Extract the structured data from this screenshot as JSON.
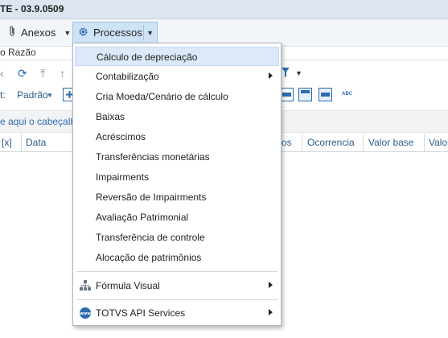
{
  "window": {
    "title": "TE - 03.9.0509"
  },
  "menubar": {
    "anexos_label": "Anexos",
    "processos_label": "Processos"
  },
  "group": {
    "label": "o Razão"
  },
  "toolbar": {
    "view_prefix": "t:",
    "view_label": "Padrão",
    "abc_label": "ABC"
  },
  "hint": {
    "text": "e aqui o cabeçalho"
  },
  "grid": {
    "columns": [
      "[x]",
      "Data",
      "os",
      "Ocorrencia",
      "Valor base",
      "Valor"
    ]
  },
  "dropdown": {
    "items": [
      {
        "label": "Cálculo de depreciação",
        "highlighted": true,
        "submenu": false
      },
      {
        "label": "Contabilização",
        "submenu": true
      },
      {
        "label": "Cria Moeda/Cenário de cálculo",
        "submenu": false
      },
      {
        "label": "Baixas",
        "submenu": false
      },
      {
        "label": "Acréscimos",
        "submenu": false
      },
      {
        "label": "Transferências monetárias",
        "submenu": false
      },
      {
        "label": "Impairments",
        "submenu": false
      },
      {
        "label": "Reversão de Impairments",
        "submenu": false
      },
      {
        "label": "Avaliação Patrimonial",
        "submenu": false
      },
      {
        "label": "Transferência de controle",
        "submenu": false
      },
      {
        "label": "Alocação de patrimônios",
        "submenu": false
      }
    ],
    "formula_visual": {
      "label": "Fórmula Visual",
      "icon": "hierarchy-icon",
      "submenu": true
    },
    "totvs_api": {
      "label": "TOTVS API Services",
      "icon": "api-globe-icon",
      "submenu": true
    }
  },
  "colors": {
    "highlight": "#dce9f8",
    "accent": "#2b6cb0",
    "menu_active": "#cfe3f7"
  }
}
